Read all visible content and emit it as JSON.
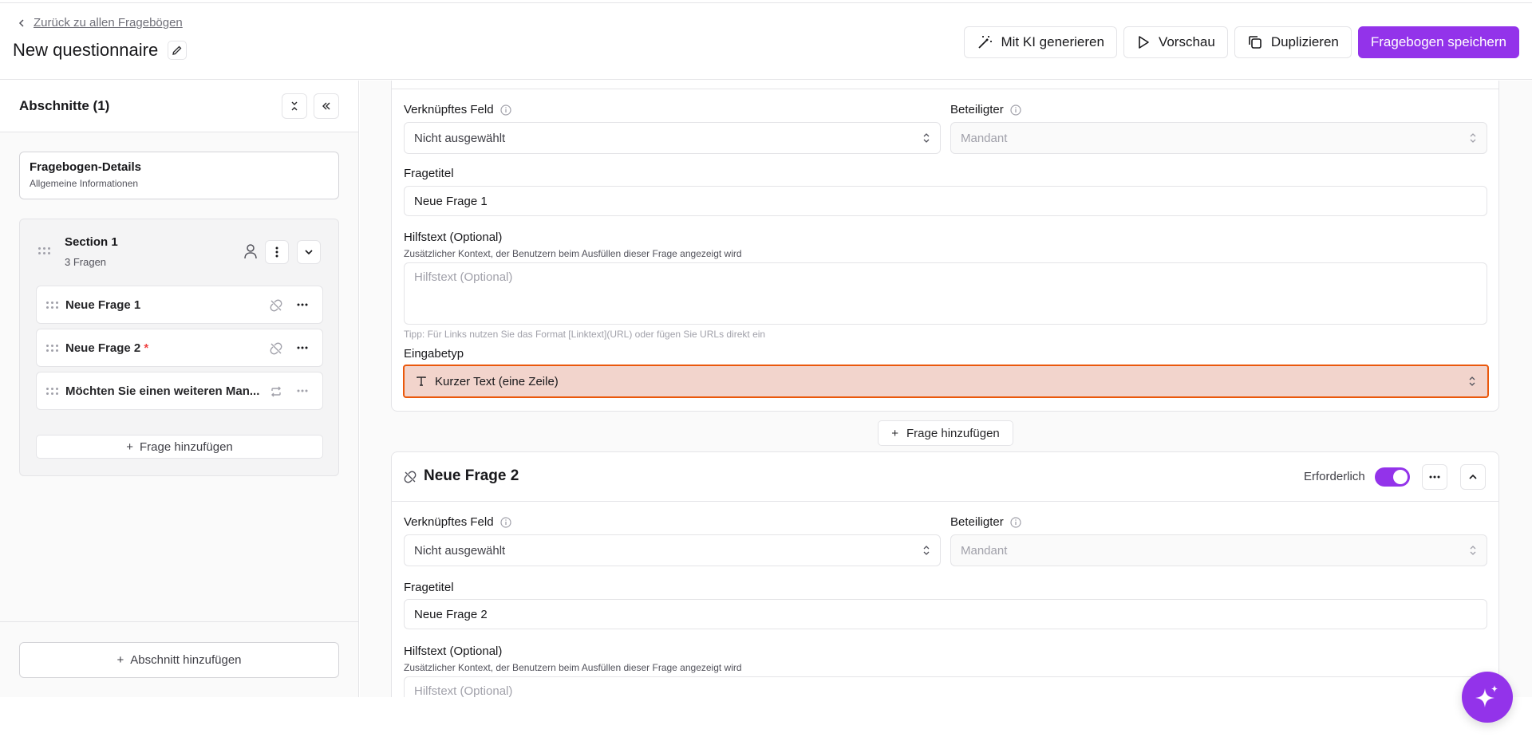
{
  "header": {
    "back_label": "Zurück zu allen Fragebögen",
    "title": "New questionnaire",
    "buttons": {
      "ai": "Mit KI generieren",
      "preview": "Vorschau",
      "duplicate": "Duplizieren",
      "save": "Fragebogen speichern"
    }
  },
  "sidebar": {
    "title": "Abschnitte (1)",
    "details": {
      "title": "Fragebogen-Details",
      "subtitle": "Allgemeine Informationen"
    },
    "section": {
      "name": "Section 1",
      "count": "3 Fragen",
      "questions": [
        {
          "label": "Neue Frage 1",
          "required": false
        },
        {
          "label": "Neue Frage 2",
          "required": true,
          "required_mark": "*"
        },
        {
          "label": "Möchten Sie einen weiteren Man...",
          "required": false
        }
      ],
      "add_question": "Frage hinzufügen"
    },
    "add_section": "Abschnitt hinzufügen"
  },
  "question1": {
    "linked_field_label": "Verknüpftes Feld",
    "linked_field_value": "Nicht ausgewählt",
    "participant_label": "Beteiligter",
    "participant_value": "Mandant",
    "title_label": "Fragetitel",
    "title_value": "Neue Frage 1",
    "help_label": "Hilfstext (Optional)",
    "help_sub": "Zusätzlicher Kontext, der Benutzern beim Ausfüllen dieser Frage angezeigt wird",
    "help_placeholder": "Hilfstext (Optional)",
    "tip": "Tipp: Für Links nutzen Sie das Format [Linktext](URL) oder fügen Sie URLs direkt ein",
    "input_type_label": "Eingabetyp",
    "input_type_value": "Kurzer Text (eine Zeile)"
  },
  "add_question_main": "Frage hinzufügen",
  "question2": {
    "title": "Neue Frage 2",
    "required_label": "Erforderlich",
    "required": true,
    "linked_field_label": "Verknüpftes Feld",
    "linked_field_value": "Nicht ausgewählt",
    "participant_label": "Beteiligter",
    "participant_value": "Mandant",
    "title_label": "Fragetitel",
    "title_value": "Neue Frage 2",
    "help_label": "Hilfstext (Optional)",
    "help_sub": "Zusätzlicher Kontext, der Benutzern beim Ausfüllen dieser Frage angezeigt wird",
    "help_placeholder": "Hilfstext (Optional)"
  },
  "colors": {
    "accent": "#9333ea",
    "highlight_border": "#ea580c",
    "highlight_bg": "#f2d4cc"
  }
}
